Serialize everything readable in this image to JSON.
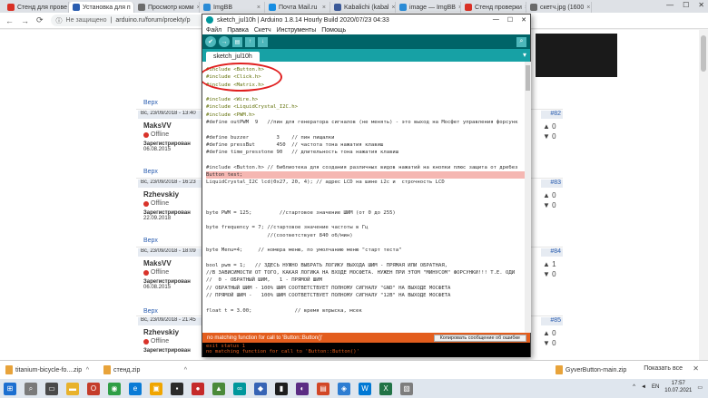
{
  "browser": {
    "tabs": [
      {
        "title": "Стенд для прове",
        "color": "#d93025",
        "active": false
      },
      {
        "title": "Установка для п",
        "color": "#2a5db0",
        "active": true
      },
      {
        "title": "Просмотр комм",
        "color": "#6b6b6b",
        "active": false
      },
      {
        "title": "ImgBB",
        "color": "#2a8bd6",
        "active": false
      },
      {
        "title": "Почта Mail.ru",
        "color": "#168de2",
        "active": false
      },
      {
        "title": "Kabalichi (kabal",
        "color": "#3b5998",
        "active": false
      },
      {
        "title": "image — ImgBB",
        "color": "#2a8bd6",
        "active": false
      },
      {
        "title": "Стенд проверки",
        "color": "#d93025",
        "active": false
      },
      {
        "title": "скетч.jpg (1600",
        "color": "#6b6b6b",
        "active": false
      }
    ],
    "window_controls": [
      "—",
      "☐",
      "✕"
    ],
    "insecure_label": "Не защищено",
    "url": "arduino.ru/forum/proekty/p"
  },
  "forum": {
    "verh_label": "Верх",
    "posts": [
      {
        "header": "Вс, 23/09/2018 - 13:40",
        "user": "MaksVV",
        "status": "Offline",
        "reg_label": "Зарегистрирован",
        "reg_date": "06.08.2015",
        "num": "#82",
        "up": "0",
        "down": "0"
      },
      {
        "header": "Вс, 23/09/2018 - 16:23",
        "user": "Rzhevskiy",
        "status": "Offline",
        "reg_label": "Зарегистрирован",
        "reg_date": "22.09.2018",
        "num": "#83",
        "up": "0",
        "down": "0"
      },
      {
        "header": "Вс, 23/09/2018 - 18:09",
        "user": "MaksVV",
        "status": "Offline",
        "reg_label": "Зарегистрирован",
        "reg_date": "06.08.2015",
        "num": "#84",
        "up": "1",
        "down": "0"
      },
      {
        "header": "Вс, 23/09/2018 - 21:45",
        "user": "Rzhevskiy",
        "status": "Offline",
        "reg_label": "Зарегистрирован",
        "reg_date": "",
        "num": "#85",
        "up": "0",
        "down": "0"
      }
    ]
  },
  "ide": {
    "title": "sketch_jul10h | Arduino 1.8.14 Hourly Build 2020/07/23 04:33",
    "menu": [
      "Файл",
      "Правка",
      "Скетч",
      "Инструменты",
      "Помощь"
    ],
    "tab": "sketch_jul10h",
    "code_lines": [
      {
        "t": "#include <Button.h>",
        "c": "inc"
      },
      {
        "t": "#include <Click.h>",
        "c": "inc"
      },
      {
        "t": "#include <Matrix.h>",
        "c": "inc"
      },
      {
        "t": "",
        "c": ""
      },
      {
        "t": "#include <Wire.h>",
        "c": "inc"
      },
      {
        "t": "#include <LiquidCrystal_I2C.h>",
        "c": "inc"
      },
      {
        "t": "#include <PWM.h>",
        "c": "inc"
      },
      {
        "t": "#define outPWM  9   //пин для генератора сигналов (не менять) - это выход на Мосфет управления форсунк",
        "c": ""
      },
      {
        "t": "",
        "c": ""
      },
      {
        "t": "#define buzzer         3    // пин пищалки",
        "c": ""
      },
      {
        "t": "#define pressBut       450  // частота тона нажатия клавиш",
        "c": ""
      },
      {
        "t": "#define time_presstone 90   // длительность тона нажатия клавиш",
        "c": ""
      },
      {
        "t": "",
        "c": ""
      },
      {
        "t": "#include <Button.h> // библиотека для создания различных видов нажатий на кнопки плюс защита от дребез",
        "c": ""
      },
      {
        "t": "Button test;",
        "c": "hl"
      },
      {
        "t": "LiquidCrystal_I2C lcd(0x27, 20, 4); // адрес LCD на шине i2c и  строчность LCD",
        "c": ""
      },
      {
        "t": "",
        "c": ""
      },
      {
        "t": "",
        "c": ""
      },
      {
        "t": "",
        "c": ""
      },
      {
        "t": "byte PWM = 125;         //стартовое значение ШИМ (от 0 до 255)",
        "c": ""
      },
      {
        "t": "",
        "c": ""
      },
      {
        "t": "byte frequency = 7; //стартовое значение частоты в Гц",
        "c": ""
      },
      {
        "t": "                    //(соответствует 840 об/мин)",
        "c": ""
      },
      {
        "t": "",
        "c": ""
      },
      {
        "t": "byte Menu=4;     // номера меню, по умолчанию меню \"старт теста\"",
        "c": ""
      },
      {
        "t": "",
        "c": ""
      },
      {
        "t": "bool pwm = 1;   // ЗДЕСЬ НУЖНО ВЫБРАТЬ ЛОГИКУ ВЫХОДА ШИМ - ПРЯМАЯ ИЛИ ОБРАТНАЯ,",
        "c": ""
      },
      {
        "t": "//В ЗАВИСИМОСТИ ОТ ТОГО, КАКАЯ ЛОГИКА НА ВХОДЕ МОСФЕТА. НУЖЕН ПРИ ЭТОМ \"МИНУСОМ\" ФОРСУНКИ!!! Т.Е. ОДИ",
        "c": ""
      },
      {
        "t": "//  0 - ОБРАТНЫЙ ШИМ,   1 - ПРЯМОЙ ШИМ",
        "c": ""
      },
      {
        "t": "// ОБРАТНЫЙ ШИМ - 100% ШИМ СООТВЕТСТВУЕТ ПОЛНОМУ СИГНАЛУ \"GND\" НА ВЫХОДЕ МОСФЕТА",
        "c": ""
      },
      {
        "t": "// ПРЯМОЙ ШИМ -   100% ШИМ СООТВЕТСТВУЕТ ПОЛНОМУ СИГНАЛУ \"12В\" НА ВЫХОДЕ МОСФЕТА",
        "c": ""
      },
      {
        "t": "",
        "c": ""
      },
      {
        "t": "float t = 3.00;              // время впрыска, мсек",
        "c": ""
      }
    ],
    "status_message": "no matching function for call to 'Button::Button()'",
    "copy_button": "Копировать сообщение об ошибке",
    "console_lines": [
      "exit status 1",
      "no matching function for call to 'Button::Button()'"
    ],
    "line_number": "14"
  },
  "downloads": {
    "items": [
      "titanium-bicycle-fo....zip",
      "стенд.zip",
      "GyverButton-main.zip"
    ],
    "show_all": "Показать все"
  },
  "taskbar": {
    "lang": "EN",
    "time": "17:57",
    "date": "10.07.2021"
  }
}
